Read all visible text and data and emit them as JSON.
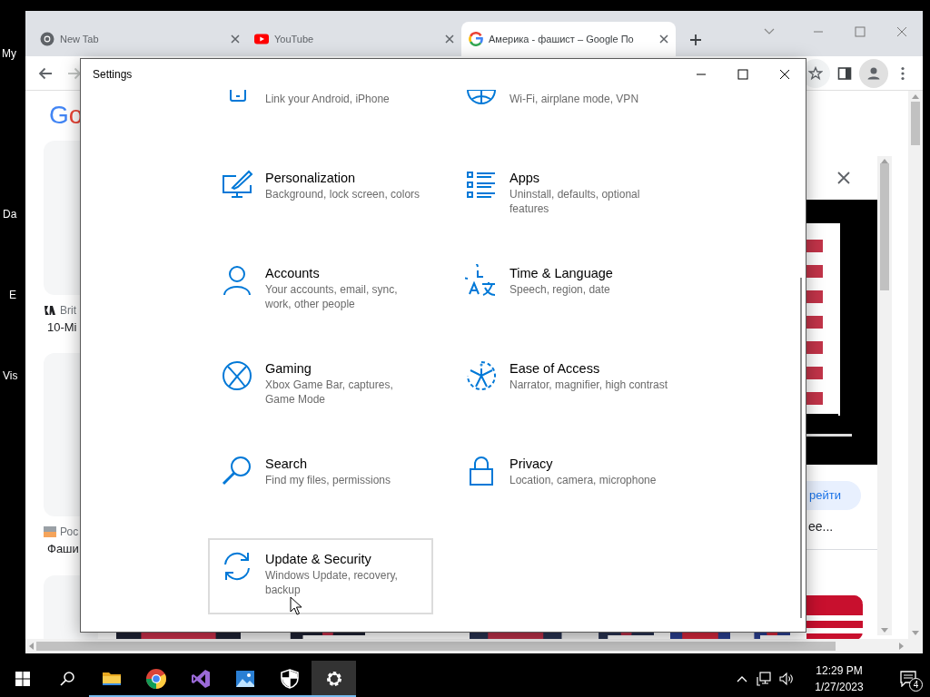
{
  "desktop_icons": [
    {
      "label": "My"
    },
    {
      "label": "Da"
    },
    {
      "label": "E"
    },
    {
      "label": "Vis"
    }
  ],
  "browser": {
    "tabs": [
      {
        "title": "New Tab",
        "selected": false
      },
      {
        "title": "YouTube",
        "selected": false
      },
      {
        "title": "Америка - фашист – Google По",
        "selected": true
      }
    ],
    "forward_disabled": true,
    "page": {
      "logo": "Go",
      "cards": [
        {
          "source": "Brit",
          "headline": "10-Mi"
        },
        {
          "source": "Рос",
          "headline": "Фаши"
        }
      ],
      "panel": {
        "button": "рейти",
        "snippet": "ее..."
      }
    }
  },
  "settings": {
    "title": "Settings",
    "items": [
      {
        "subtitle": "Link your Android, iPhone",
        "hovered": false
      },
      {
        "subtitle": "Wi-Fi, airplane mode, VPN",
        "hovered": false
      },
      {
        "title": "Personalization",
        "subtitle": "Background, lock screen, colors",
        "hovered": false
      },
      {
        "title": "Apps",
        "subtitle": "Uninstall, defaults, optional features",
        "hovered": false
      },
      {
        "title": "Accounts",
        "subtitle": "Your accounts, email, sync, work, other people",
        "hovered": false
      },
      {
        "title": "Time & Language",
        "subtitle": "Speech, region, date",
        "hovered": false
      },
      {
        "title": "Gaming",
        "subtitle": "Xbox Game Bar, captures, Game Mode",
        "hovered": false
      },
      {
        "title": "Ease of Access",
        "subtitle": "Narrator, magnifier, high contrast",
        "hovered": false
      },
      {
        "title": "Search",
        "subtitle": "Find my files, permissions",
        "hovered": false
      },
      {
        "title": "Privacy",
        "subtitle": "Location, camera, microphone",
        "hovered": false
      },
      {
        "title": "Update & Security",
        "subtitle": "Windows Update, recovery, backup",
        "hovered": true
      }
    ]
  },
  "taskbar": {
    "apps": [
      {
        "running": true,
        "selected": false
      },
      {
        "running": true,
        "selected": false
      },
      {
        "running": true,
        "selected": false
      },
      {
        "running": true,
        "selected": false
      },
      {
        "running": true,
        "selected": false
      },
      {
        "running": true,
        "selected": true
      }
    ],
    "time": "12:29 PM",
    "date": "1/27/2023",
    "notifications": "4"
  }
}
